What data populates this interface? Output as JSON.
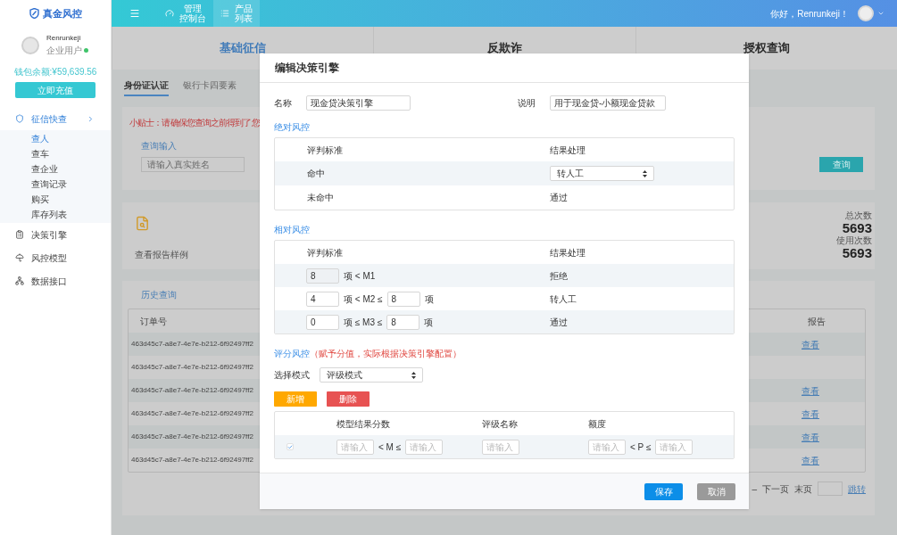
{
  "sidebar": {
    "logo": "真金风控",
    "user": {
      "name": "Renrunkeji",
      "role": "企业用户",
      "online": true
    },
    "balance": "钱包余额:¥59,639.56",
    "recharge_button": "立即充值",
    "menu": [
      {
        "label": "征信快查",
        "selected": true,
        "children": [
          {
            "label": "查人",
            "selected": true
          },
          {
            "label": "查车",
            "selected": false
          },
          {
            "label": "查企业",
            "selected": false
          },
          {
            "label": "查询记录",
            "selected": false
          },
          {
            "label": "购买",
            "selected": false
          },
          {
            "label": "库存列表",
            "selected": false
          }
        ]
      },
      {
        "label": "决策引擎",
        "selected": false
      },
      {
        "label": "风控模型",
        "selected": false
      },
      {
        "label": "数据接口",
        "selected": false
      }
    ]
  },
  "topbar": {
    "nav": [
      {
        "label_lines": [
          "管理",
          "控制台"
        ],
        "selected": false
      },
      {
        "label_lines": [
          "产品",
          "列表"
        ],
        "selected": true
      }
    ],
    "greeting": "你好，Renrunkeji！"
  },
  "page": {
    "tabs": [
      {
        "label": "基础征信",
        "selected": true
      },
      {
        "label": "反欺诈",
        "selected": false
      },
      {
        "label": "授权查询",
        "selected": false
      }
    ],
    "subtabs": [
      {
        "label": "身份证认证",
        "selected": true
      },
      {
        "label": "银行卡四要素",
        "selected": false
      }
    ],
    "tip": "小贴士：请确保您查询之前得到了您",
    "query_label": "查询输入",
    "name_placeholder": "请输入真实姓名",
    "query_button": "查询",
    "sample_link": "查看报告样例",
    "stats": [
      {
        "label": "总次数",
        "value": "5693"
      },
      {
        "label": "使用次数",
        "value": "5693"
      }
    ],
    "history": {
      "title": "历史查询",
      "columns": [
        "订单号",
        "报告"
      ],
      "rows": [
        {
          "order": "463d45c7-a8e7-4e7e-b212-6f92497ff2",
          "report": "查看"
        },
        {
          "order": "463d45c7-a8e7-4e7e-b212-6f92497ff2"
        },
        {
          "order": "463d45c7-a8e7-4e7e-b212-6f92497ff2",
          "report": "查看"
        },
        {
          "order": "463d45c7-a8e7-4e7e-b212-6f92497ff2",
          "report": "查看"
        },
        {
          "order": "463d45c7-a8e7-4e7e-b212-6f92497ff2",
          "report": "查看"
        },
        {
          "order": "463d45c7-a8e7-4e7e-b212-6f92497ff2",
          "report": "查看"
        }
      ]
    },
    "pagination": {
      "dash": "–",
      "next": "下一页",
      "last": "末页",
      "jump": "跳转"
    }
  },
  "dialog": {
    "title": "编辑决策引擎",
    "name_label": "名称",
    "name_value": "现金贷决策引擎",
    "desc_label": "说明",
    "desc_value": "用于现金贷-小额现金贷款",
    "absolute": {
      "title": "绝对风控",
      "columns": [
        "评判标准",
        "结果处理"
      ],
      "rows": [
        {
          "criterion": "命中",
          "kind": "select",
          "result": "转人工"
        },
        {
          "criterion": "未命中",
          "kind": "text",
          "result": "通过"
        }
      ]
    },
    "relative": {
      "title": "相对风控",
      "columns": [
        "评判标准",
        "结果处理"
      ],
      "rows": [
        {
          "parts": [
            {
              "kind": "input",
              "value": "8",
              "disabled": true
            },
            {
              "kind": "text",
              "text": "项 < M1"
            }
          ],
          "result": "拒绝"
        },
        {
          "parts": [
            {
              "kind": "input",
              "value": "4",
              "disabled": false
            },
            {
              "kind": "text",
              "text": "项 < M2 ≤"
            },
            {
              "kind": "input",
              "value": "8",
              "disabled": false
            },
            {
              "kind": "text",
              "text": "项"
            }
          ],
          "result": "转人工"
        },
        {
          "parts": [
            {
              "kind": "input",
              "value": "0",
              "disabled": false
            },
            {
              "kind": "text",
              "text": "项 ≤ M3 ≤"
            },
            {
              "kind": "input",
              "value": "8",
              "disabled": false
            },
            {
              "kind": "text",
              "text": "项"
            }
          ],
          "result": "通过"
        }
      ]
    },
    "score": {
      "title": "评分风控",
      "note": "（赋予分值，实际根据决策引擎配置）",
      "mode_label": "选择模式",
      "mode_value": "评级模式",
      "add_button": "新增",
      "delete_button": "删除",
      "columns": [
        "模型结果分数",
        "评级名称",
        "额度"
      ],
      "rows": [
        {
          "checked": true,
          "score_min_placeholder": "请输入",
          "score_op": "< M ≤",
          "score_max_placeholder": "请输入",
          "grade_placeholder": "请输入",
          "limit_min_placeholder": "请输入",
          "limit_op": "< P ≤",
          "limit_max_placeholder": "请输入"
        }
      ]
    },
    "save_button": "保存",
    "cancel_button": "取消"
  }
}
